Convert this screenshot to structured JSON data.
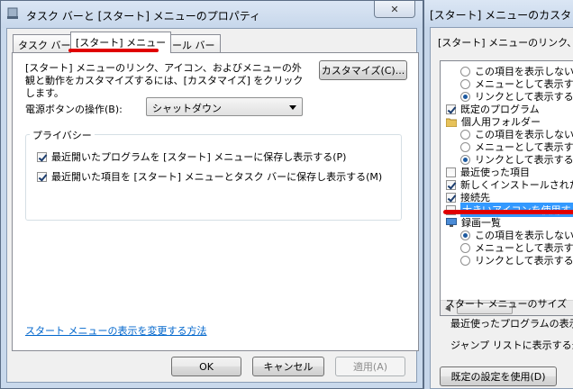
{
  "window1": {
    "title": "タスク バーと [スタート] メニューのプロパティ",
    "close_label": "✕",
    "tabs": [
      {
        "label": "タスク バー"
      },
      {
        "label": "[スタート] メニュー"
      },
      {
        "label": "ツール バー"
      }
    ],
    "description": "[スタート] メニューのリンク、アイコン、およびメニューの外観と動作をカスタマイズするには、[カスタマイズ] をクリックします。",
    "customize_button": "カスタマイズ(C)...",
    "power_label": "電源ボタンの操作(B):",
    "power_value": "シャットダウン",
    "privacy_group": "プライバシー",
    "privacy_items": [
      {
        "label": "最近開いたプログラムを [スタート] メニューに保存し表示する(P)",
        "checked": true
      },
      {
        "label": "最近開いた項目を [スタート] メニューとタスク バーに保存し表示する(M)",
        "checked": true
      }
    ],
    "help_link": "スタート メニューの表示を変更する方法",
    "ok_button": "OK",
    "cancel_button": "キャンセル",
    "apply_button": "適用(A)"
  },
  "window2": {
    "title": "[スタート] メニューのカスタ",
    "description": "[スタート] メニューのリンク、アイコ",
    "list_items": [
      {
        "type": "radio",
        "label": "この項目を表示しない",
        "checked": false
      },
      {
        "type": "radio",
        "label": "メニューとして表示する",
        "checked": false
      },
      {
        "type": "radio",
        "label": "リンクとして表示する",
        "checked": true
      },
      {
        "type": "checkbox",
        "label": "既定のプログラム",
        "checked": true
      },
      {
        "type": "folder",
        "label": "個人用フォルダー"
      },
      {
        "type": "radio",
        "label": "この項目を表示しない",
        "checked": false
      },
      {
        "type": "radio",
        "label": "メニューとして表示する",
        "checked": false
      },
      {
        "type": "radio",
        "label": "リンクとして表示する",
        "checked": true
      },
      {
        "type": "checkbox",
        "label": "最近使った項目",
        "checked": false
      },
      {
        "type": "checkbox",
        "label": "新しくインストールされたプ",
        "checked": true
      },
      {
        "type": "checkbox",
        "label": "接続先",
        "checked": true
      },
      {
        "type": "checkbox",
        "label": "大きいアイコンを使用する",
        "checked": false,
        "selected": true
      },
      {
        "type": "monitor",
        "label": "録画一覧"
      },
      {
        "type": "radio",
        "label": "この項目を表示しない",
        "checked": true
      },
      {
        "type": "radio",
        "label": "メニューとして表示する",
        "checked": false
      },
      {
        "type": "radio",
        "label": "リンクとして表示する",
        "checked": false
      }
    ],
    "size_group": "スタート メニューのサイズ",
    "recent_programs_label": "最近使ったプログラムの表示",
    "jump_list_label": "ジャンプ リストに表示する最近",
    "default_button": "既定の設定を使用(D)"
  },
  "colors": {
    "highlight": "#3399ff",
    "annotation": "#e00000",
    "link": "#0066cc"
  }
}
